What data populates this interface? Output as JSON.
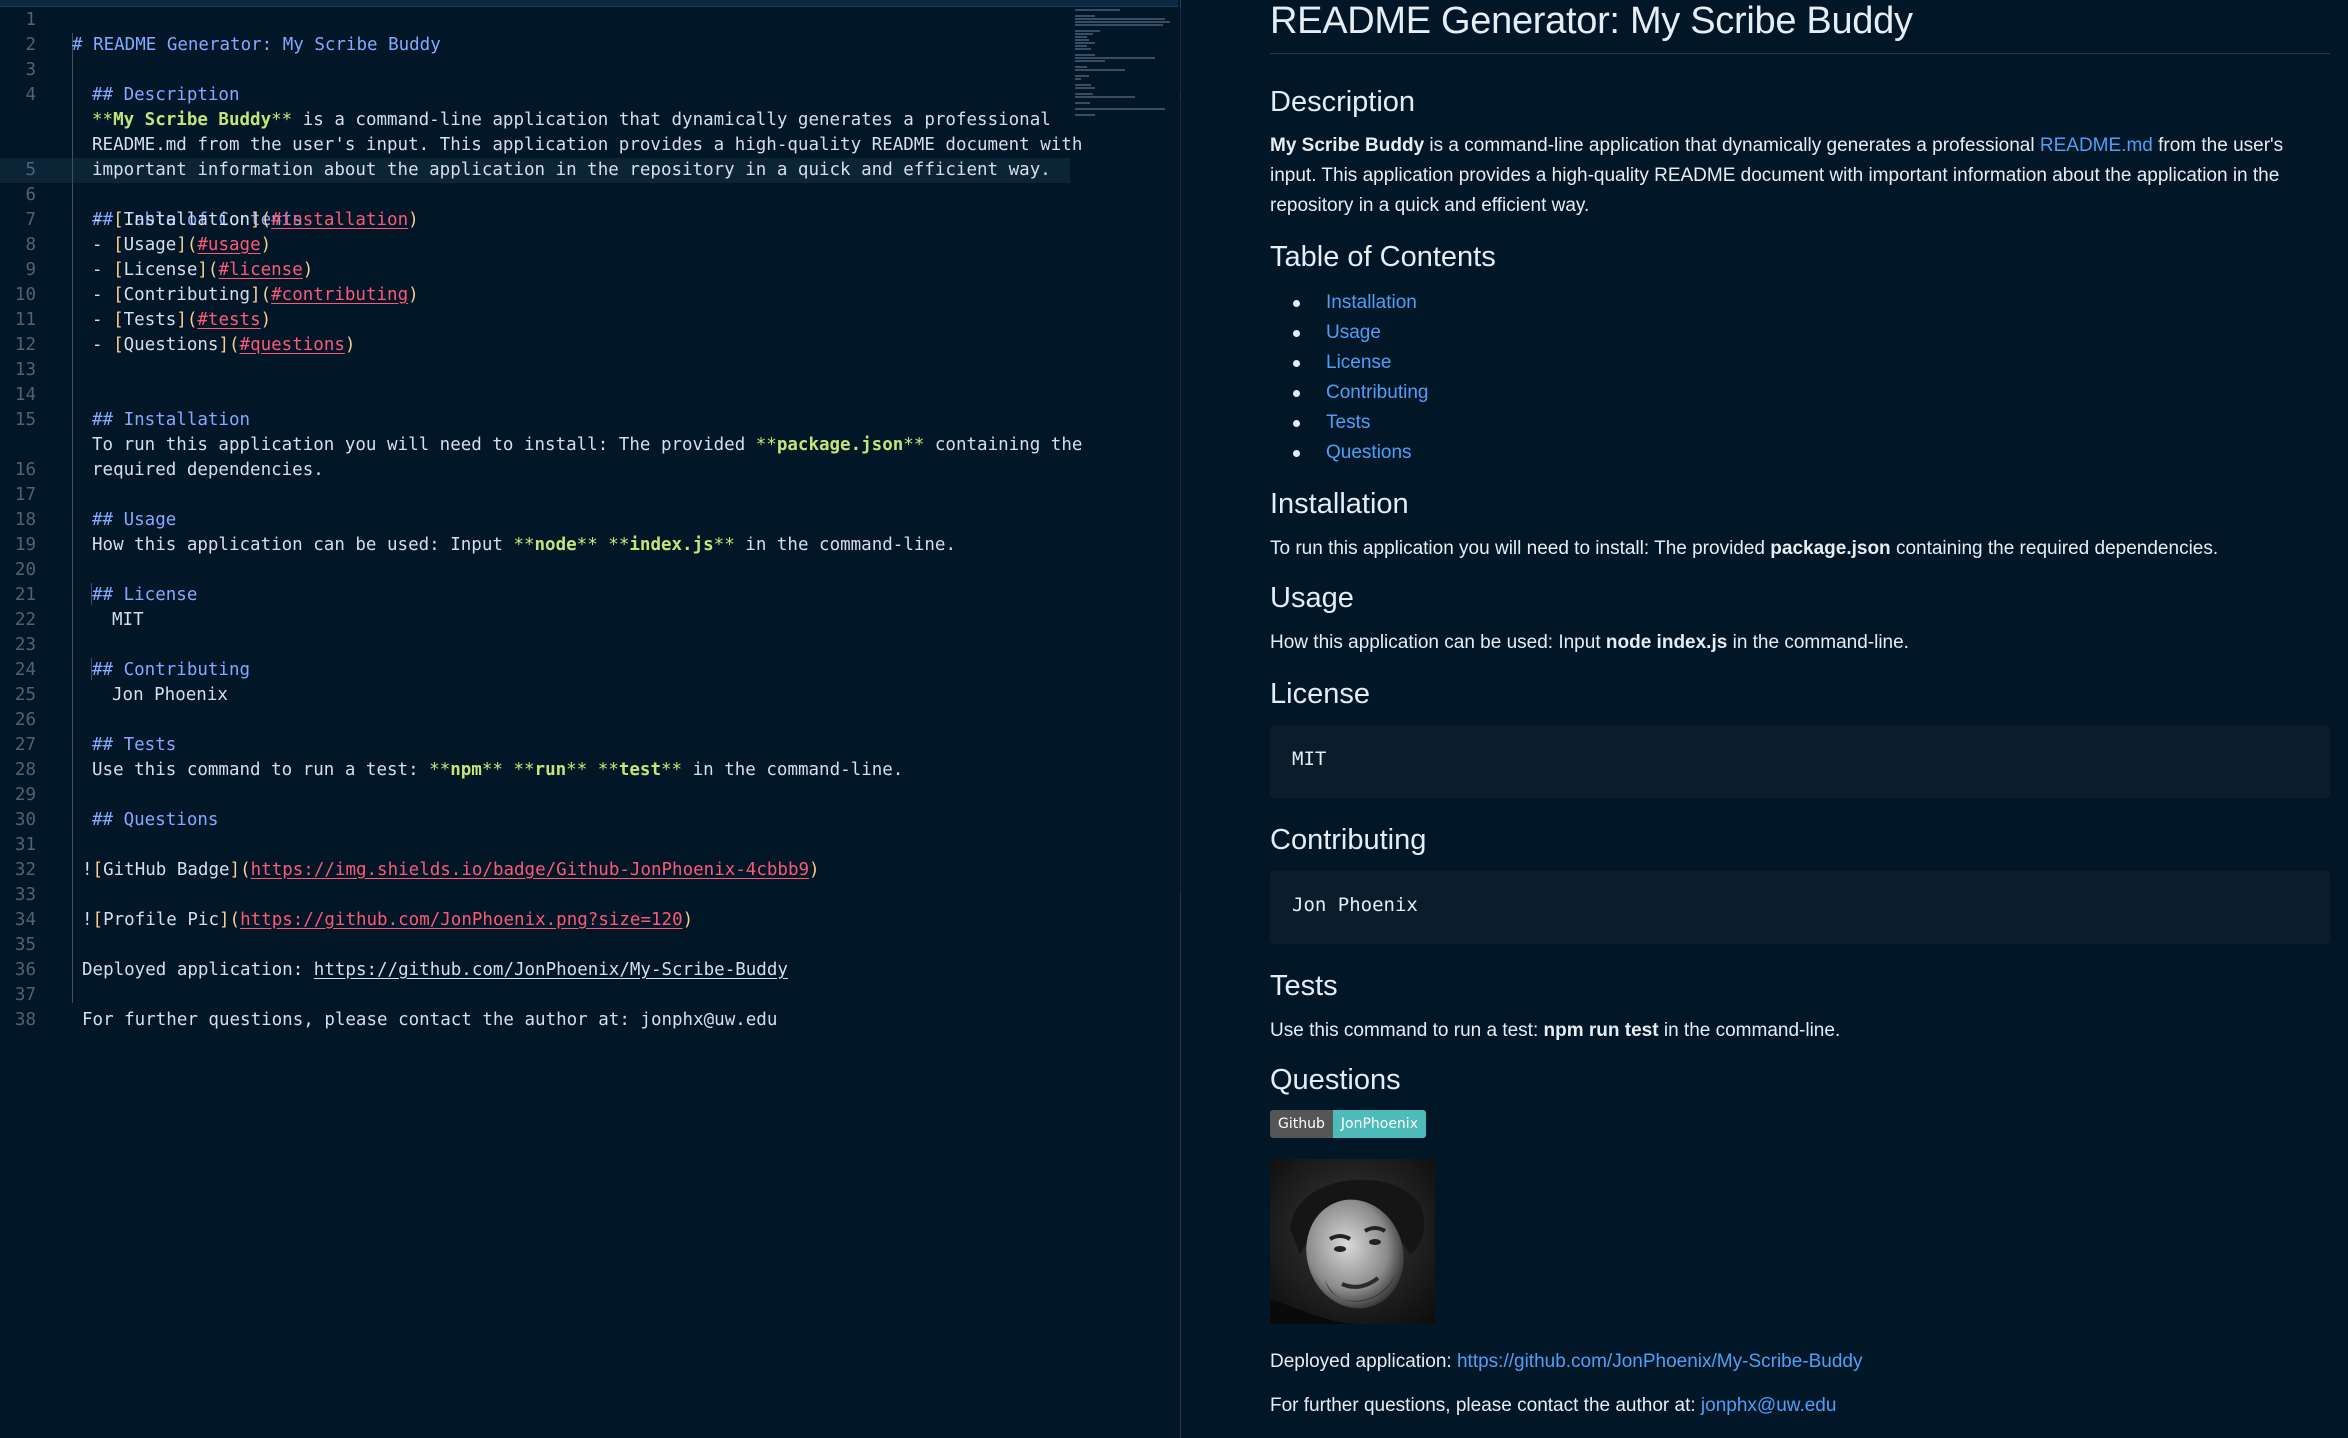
{
  "editor": {
    "lines": [
      {
        "n": "1"
      },
      {
        "n": "2"
      },
      {
        "n": "3"
      },
      {
        "n": "4"
      },
      {
        "n": "5"
      },
      {
        "n": "6"
      },
      {
        "n": "7"
      },
      {
        "n": "8"
      },
      {
        "n": "9"
      },
      {
        "n": "10"
      },
      {
        "n": "11"
      },
      {
        "n": "12"
      },
      {
        "n": "13"
      },
      {
        "n": "14"
      },
      {
        "n": "15"
      },
      {
        "n": "16"
      },
      {
        "n": "17"
      },
      {
        "n": "18"
      },
      {
        "n": "19"
      },
      {
        "n": "20"
      },
      {
        "n": "21"
      },
      {
        "n": "22"
      },
      {
        "n": "23"
      },
      {
        "n": "24"
      },
      {
        "n": "25"
      },
      {
        "n": "26"
      },
      {
        "n": "27"
      },
      {
        "n": "28"
      },
      {
        "n": "29"
      },
      {
        "n": "30"
      },
      {
        "n": "31"
      },
      {
        "n": "32"
      },
      {
        "n": "33"
      },
      {
        "n": "34"
      },
      {
        "n": "35"
      },
      {
        "n": "36"
      },
      {
        "n": "37"
      },
      {
        "n": "38"
      }
    ],
    "l1": "# README Generator: My Scribe Buddy",
    "l3": "## Description",
    "l4a_star": "**",
    "l4a_bold": "My Scribe Buddy",
    "l4a_star2": "**",
    "l4a_rest": " is a command-line application that dynamically generates a professional",
    "l4b": "README.md from the user's input. This application provides a high-quality README document with",
    "l4c": "important information about the application in the repository in a quick and efficient way.",
    "l6": "## Table of Contents",
    "toc": [
      {
        "label": "Installation",
        "anchor": "#installation"
      },
      {
        "label": "Usage",
        "anchor": "#usage"
      },
      {
        "label": "License",
        "anchor": "#license"
      },
      {
        "label": "Contributing",
        "anchor": "#contributing"
      },
      {
        "label": "Tests",
        "anchor": "#tests"
      },
      {
        "label": "Questions",
        "anchor": "#questions"
      }
    ],
    "l14": "## Installation",
    "l15a_pre": "To run this application you will need to install: The provided ",
    "l15a_star": "**",
    "l15a_bold": "package.json",
    "l15a_star2": "**",
    "l15a_post": " containing the",
    "l15b": "required dependencies.",
    "l17": "## Usage",
    "l18_pre": "How this application can be used: Input ",
    "l18_b1": "node",
    "l18_b2": "index.js",
    "l18_post": " in the command-line.",
    "l20": "## License",
    "l21": "MIT",
    "l23": "## Contributing",
    "l24": "Jon Phoenix",
    "l26": "## Tests",
    "l27_pre": "Use this command to run a test: ",
    "l27_b1": "npm",
    "l27_b2": "run",
    "l27_b3": "test",
    "l27_post": " in the command-line.",
    "l29": "## Questions",
    "l31_alt": "GitHub Badge",
    "l31_url": "https://img.shields.io/badge/Github-JonPhoenix-4cbbb9",
    "l33_alt": "Profile Pic",
    "l33_url": "https://github.com/JonPhoenix.png?size=120",
    "l35_pre": "Deployed application: ",
    "l35_url": "https://github.com/JonPhoenix/My-Scribe-Buddy",
    "l37": "For further questions, please contact the author at: jonphx@uw.edu"
  },
  "preview": {
    "title": "README Generator: My Scribe Buddy",
    "h_description": "Description",
    "desc_bold": "My Scribe Buddy",
    "desc_mid": " is a command-line application that dynamically generates a professional ",
    "desc_link": "README.md",
    "desc_rest": " from the user's input. This application provides a high-quality README document with important information about the application in the repository in a quick and efficient way.",
    "h_toc": "Table of Contents",
    "toc": [
      "Installation",
      "Usage",
      "License",
      "Contributing",
      "Tests",
      "Questions"
    ],
    "h_installation": "Installation",
    "install_pre": "To run this application you will need to install: The provided ",
    "install_bold": "package.json",
    "install_post": " containing the required dependencies.",
    "h_usage": "Usage",
    "usage_pre": "How this application can be used: Input ",
    "usage_bold": "node index.js",
    "usage_post": " in the command-line.",
    "h_license": "License",
    "license": "MIT",
    "h_contributing": "Contributing",
    "contributing": "Jon Phoenix",
    "h_tests": "Tests",
    "tests_pre": "Use this command to run a test: ",
    "tests_bold": "npm run test",
    "tests_post": " in the command-line.",
    "h_questions": "Questions",
    "badge_left": "Github",
    "badge_right": "JonPhoenix",
    "deployed_pre": "Deployed application: ",
    "deployed_link": "https://github.com/JonPhoenix/My-Scribe-Buddy",
    "contact_pre": "For further questions, please contact the author at: ",
    "contact_link": "jonphx@uw.edu"
  },
  "colors": {
    "background": "#011627",
    "heading_syntax": "#82aaff",
    "bold_syntax": "#c5e478",
    "link_syntax": "#ff5874",
    "bracket_syntax": "#ffcb8b",
    "preview_link": "#4ea0f7",
    "badge_right": "#4cbbb9"
  }
}
